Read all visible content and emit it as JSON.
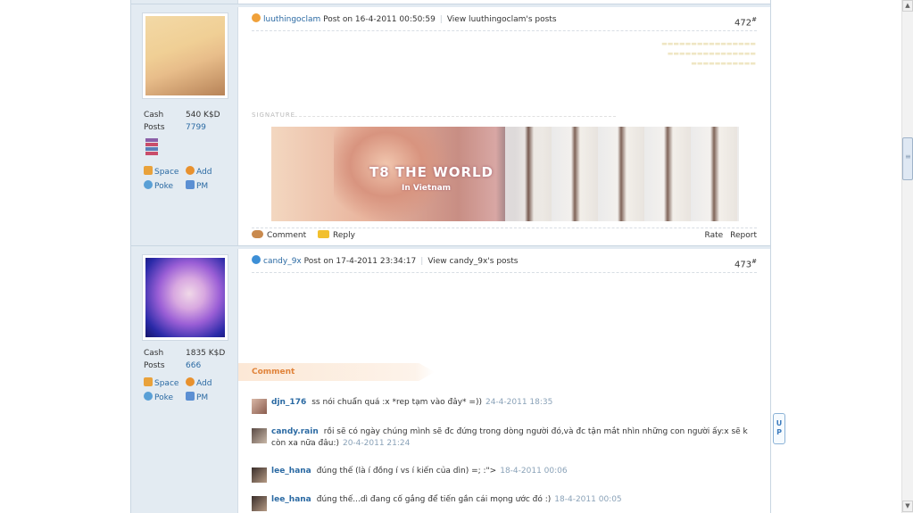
{
  "posts": [
    {
      "author": "luuthingoclam",
      "post_label": "Post on 16-4-2011 00:50:59",
      "view_posts": "View luuthingoclam's posts",
      "number": "472",
      "floor_mark": "#",
      "cash_label": "Cash",
      "cash_value": "540 K$D",
      "posts_label": "Posts",
      "posts_value": "7799",
      "star_color": "#f0a13a",
      "avatar_colors": [
        "#f3d9a6",
        "#e8bd8a",
        "#b78358"
      ]
    },
    {
      "author": "candy_9x",
      "post_label": "Post on 17-4-2011 23:34:17",
      "view_posts": "View candy_9x's posts",
      "number": "473",
      "floor_mark": "#",
      "cash_label": "Cash",
      "cash_value": "1835 K$D",
      "posts_label": "Posts",
      "posts_value": "666",
      "star_color": "#3d8fd6",
      "avatar_colors": [
        "#2a2aa8",
        "#9b5fd6",
        "#f0d8e8"
      ]
    }
  ],
  "actions": {
    "space": "Space",
    "add": "Add",
    "poke": "Poke",
    "pm": "PM"
  },
  "signature": {
    "label": "SIGNATURE",
    "banner_title": "T8 THE WORLD",
    "banner_sub": "In Vietnam"
  },
  "post_footer": {
    "comment": "Comment",
    "reply": "Reply",
    "rate": "Rate",
    "report": "Report"
  },
  "comment_section": {
    "title": "Comment",
    "items": [
      {
        "user": "djn_176",
        "text": "ss nói chuẩn quá :x *rep tạm vào đây* =))",
        "time": "24-4-2011 18:35"
      },
      {
        "user": "candy.rain",
        "text": "rồi sẽ có ngày chúng mình sẽ đc đứng trong dòng người đó,và đc tận mắt nhìn những con người ấy:x sẽ k còn xa nữa đâu:)",
        "time": "20-4-2011 21:24"
      },
      {
        "user": "lee_hana",
        "text": "đúng thế (là í đồng í vs í kiến của dìn) =; :\">",
        "time": "18-4-2011 00:06"
      },
      {
        "user": "lee_hana",
        "text": "đúng thế...dì đang cố gắng để tiến gần cái mọng ước đó :)",
        "time": "18-4-2011 00:05"
      }
    ]
  },
  "up_button": "UP",
  "colors": {
    "link": "#2b6aa3",
    "sidebar_bg": "#e3ebf2",
    "comment_accent": "#e0833a"
  },
  "icons": [
    "home-icon",
    "add-friend-icon",
    "poke-icon",
    "mail-icon",
    "comment-icon",
    "reply-icon",
    "star-icon"
  ]
}
